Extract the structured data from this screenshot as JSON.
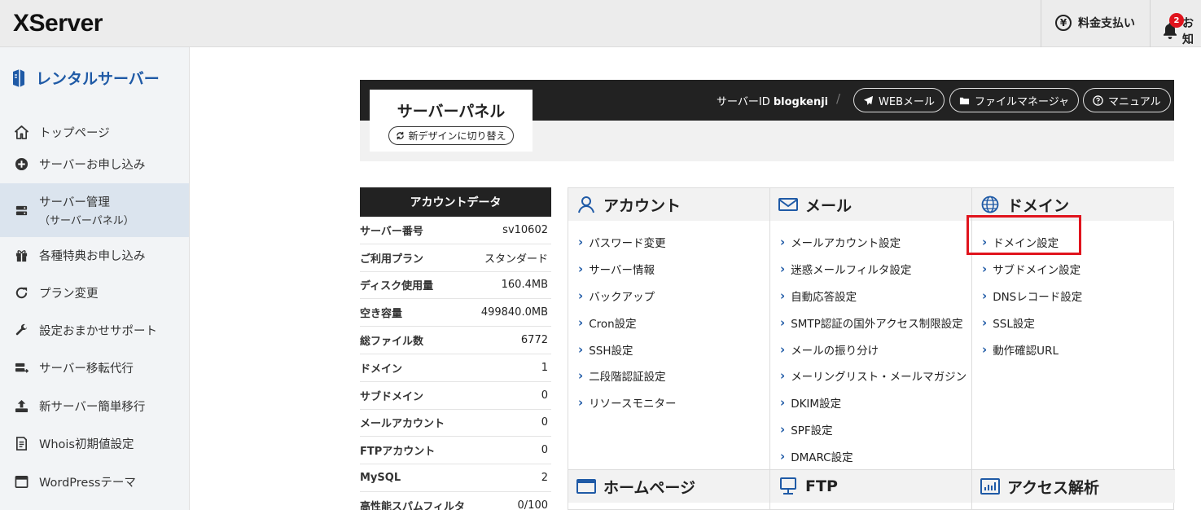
{
  "topbar": {
    "logo": "XServer",
    "billing_label": "料金支払い",
    "notice_label": "お知",
    "notice_count": "2"
  },
  "sidebar": {
    "title": "レンタルサーバー",
    "items": [
      {
        "label": "トップページ",
        "icon": "home-icon"
      },
      {
        "label": "サーバーお申し込み",
        "icon": "plus-circle-icon"
      },
      {
        "label": "サーバー管理",
        "sub": "（サーバーパネル）",
        "icon": "server-icon",
        "active": true
      },
      {
        "label": "各種特典お申し込み",
        "icon": "gift-icon"
      },
      {
        "label": "プラン変更",
        "icon": "refresh-icon"
      },
      {
        "label": "設定おまかせサポート",
        "icon": "wrench-icon"
      },
      {
        "label": "サーバー移転代行",
        "icon": "server-move-icon"
      },
      {
        "label": "新サーバー簡単移行",
        "icon": "upload-icon"
      },
      {
        "label": "Whois初期値設定",
        "icon": "document-icon"
      },
      {
        "label": "WordPressテーマ",
        "icon": "window-icon"
      }
    ]
  },
  "panel": {
    "title": "サーバーパネル",
    "new_design": "新デザインに切り替え",
    "server_id_label": "サーバーID",
    "server_id": "blogkenji",
    "buttons": {
      "webmail": "WEBメール",
      "file_manager": "ファイルマネージャ",
      "manual": "マニュアル"
    }
  },
  "account": {
    "title": "アカウントデータ",
    "rows": [
      {
        "k": "サーバー番号",
        "v": "sv10602"
      },
      {
        "k": "ご利用プラン",
        "v": "スタンダード"
      },
      {
        "k": "ディスク使用量",
        "v": "160.4MB"
      },
      {
        "k": "空き容量",
        "v": "499840.0MB"
      },
      {
        "k": "総ファイル数",
        "v": "6772"
      },
      {
        "k": "ドメイン",
        "v": "1"
      },
      {
        "k": "サブドメイン",
        "v": "0"
      },
      {
        "k": "メールアカウント",
        "v": "0"
      },
      {
        "k": "FTPアカウント",
        "v": "0"
      },
      {
        "k": "MySQL",
        "v": "2"
      },
      {
        "k": "高性能スパムフィルタ",
        "v": "0/100"
      }
    ]
  },
  "sections": {
    "account": {
      "title": "アカウント",
      "links": [
        "パスワード変更",
        "サーバー情報",
        "バックアップ",
        "Cron設定",
        "SSH設定",
        "二段階認証設定",
        "リソースモニター"
      ]
    },
    "mail": {
      "title": "メール",
      "links": [
        "メールアカウント設定",
        "迷惑メールフィルタ設定",
        "自動応答設定",
        "SMTP認証の国外アクセス制限設定",
        "メールの振り分け",
        "メーリングリスト・メールマガジン",
        "DKIM設定",
        "SPF設定",
        "DMARC設定"
      ]
    },
    "domain": {
      "title": "ドメイン",
      "links": [
        "ドメイン設定",
        "サブドメイン設定",
        "DNSレコード設定",
        "SSL設定",
        "動作確認URL"
      ]
    },
    "homepage": {
      "title": "ホームページ"
    },
    "ftp": {
      "title": "FTP"
    },
    "access": {
      "title": "アクセス解析"
    }
  }
}
